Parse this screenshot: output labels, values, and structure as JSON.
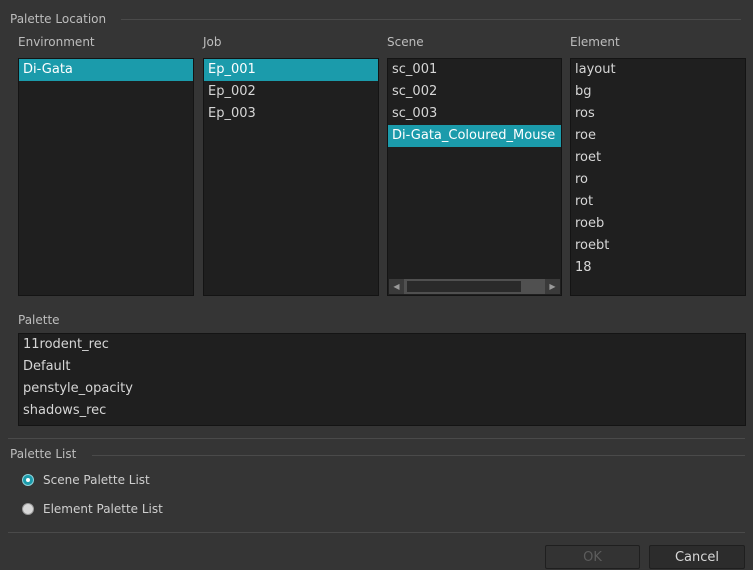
{
  "palette_location": {
    "group_title": "Palette Location",
    "environment": {
      "header": "Environment",
      "items": [
        "Di-Gata"
      ],
      "selected": 0
    },
    "job": {
      "header": "Job",
      "items": [
        "Ep_001",
        "Ep_002",
        "Ep_003"
      ],
      "selected": 0
    },
    "scene": {
      "header": "Scene",
      "items": [
        "sc_001",
        "sc_002",
        "sc_003",
        "Di-Gata_Coloured_Mouse"
      ],
      "selected": 3
    },
    "element": {
      "header": "Element",
      "items": [
        "layout",
        "bg",
        "ros",
        "roe",
        "roet",
        "ro",
        "rot",
        "roeb",
        "roebt",
        "18"
      ]
    },
    "palette": {
      "header": "Palette",
      "items": [
        "11rodent_rec",
        "Default",
        "penstyle_opacity",
        "shadows_rec"
      ]
    }
  },
  "palette_list": {
    "group_title": "Palette List",
    "options": [
      {
        "label": "Scene Palette List",
        "checked": true
      },
      {
        "label": "Element Palette List",
        "checked": false
      }
    ]
  },
  "buttons": {
    "ok": "OK",
    "cancel": "Cancel"
  },
  "colors": {
    "background": "#353535",
    "list_background": "#1f1f1f",
    "selection": "#1b9bab"
  }
}
